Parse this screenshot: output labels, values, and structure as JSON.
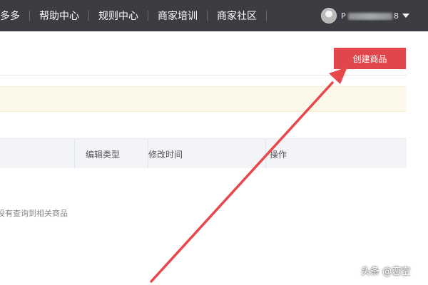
{
  "topbar": {
    "items": [
      {
        "label": "多多"
      },
      {
        "label": "帮助中心"
      },
      {
        "label": "规则中心"
      },
      {
        "label": "商家培训"
      },
      {
        "label": "商家社区"
      }
    ],
    "user": {
      "name_start": "P",
      "name_end": "8"
    }
  },
  "main": {
    "create_button": "创建商品",
    "table": {
      "columns": [
        "编辑类型",
        "修改时间",
        "操作"
      ]
    },
    "empty_text": "没有查询到相关商品"
  },
  "annotation": {
    "color": "#e8474c"
  },
  "watermark": "头条 @恋空"
}
